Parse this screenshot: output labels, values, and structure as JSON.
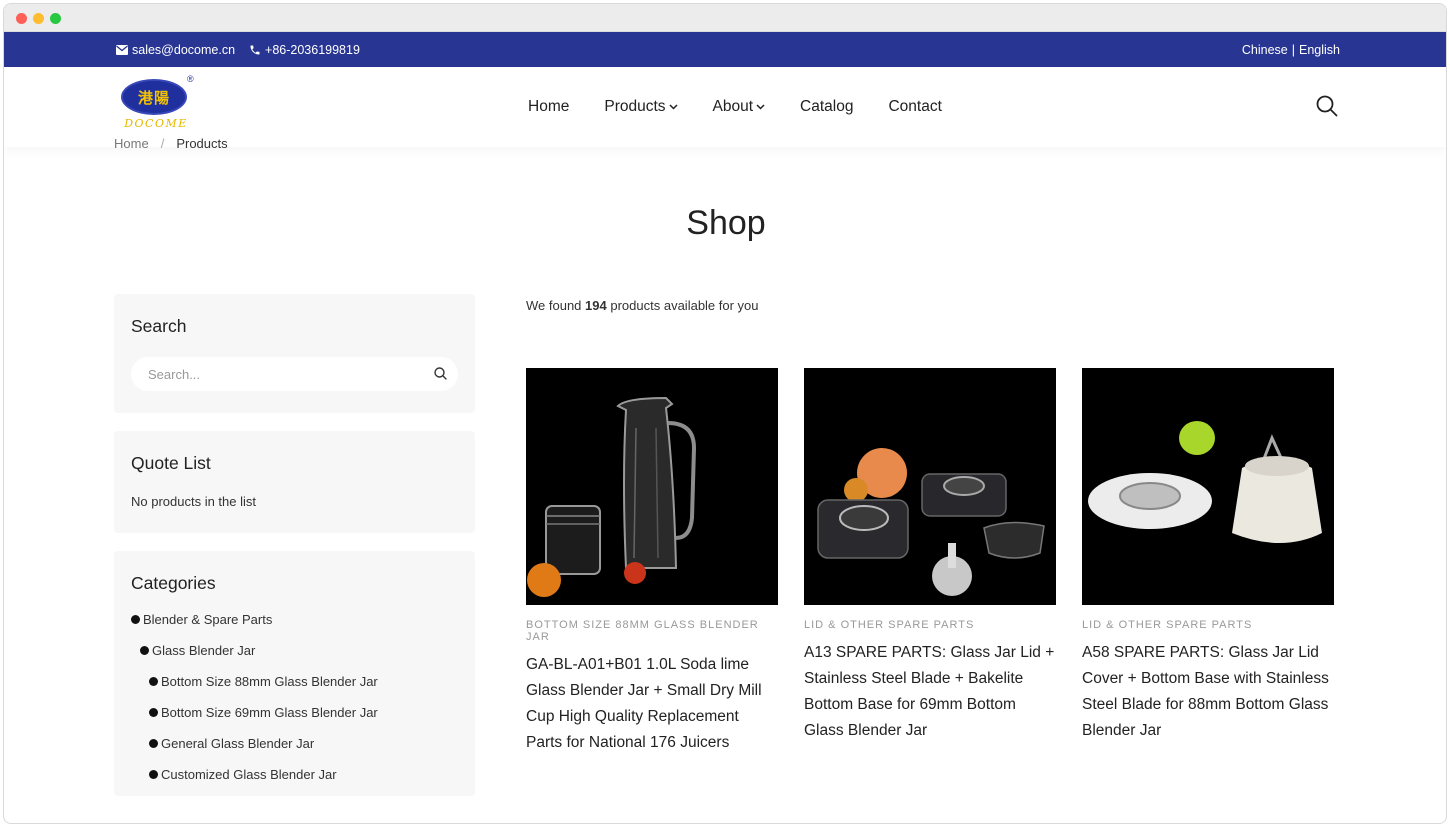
{
  "topbar": {
    "email": "sales@docome.cn",
    "phone": "+86-2036199819",
    "lang_chinese": "Chinese",
    "lang_sep": "|",
    "lang_english": "English"
  },
  "logo": {
    "cn": "港陽",
    "wordmark": "DOCOME",
    "reg": "®"
  },
  "nav": {
    "home": "Home",
    "products": "Products",
    "about": "About",
    "catalog": "Catalog",
    "contact": "Contact"
  },
  "breadcrumb": {
    "home": "Home",
    "sep": "/",
    "current": "Products"
  },
  "page_title": "Shop",
  "sidebar": {
    "search_title": "Search",
    "search_placeholder": "Search...",
    "quote_title": "Quote List",
    "quote_empty": "No products in the list",
    "categories_title": "Categories",
    "categories": [
      {
        "label": "Blender & Spare Parts",
        "level": 0
      },
      {
        "label": "Glass Blender Jar",
        "level": 1
      },
      {
        "label": "Bottom Size 88mm Glass Blender Jar",
        "level": 2
      },
      {
        "label": "Bottom Size 69mm Glass Blender Jar",
        "level": 2
      },
      {
        "label": "General Glass Blender Jar",
        "level": 2
      },
      {
        "label": "Customized Glass Blender Jar",
        "level": 2
      }
    ]
  },
  "results": {
    "prefix": "We found",
    "count": "194",
    "suffix": "products available for you"
  },
  "products": [
    {
      "category": "BOTTOM SIZE 88MM GLASS BLENDER JAR",
      "title": "GA-BL-A01+B01 1.0L Soda lime Glass Blender Jar + Small Dry Mill Cup High Quality Replacement Parts for National 176 Juicers"
    },
    {
      "category": "LID & OTHER SPARE PARTS",
      "title": "A13 SPARE PARTS: Glass Jar Lid + Stainless Steel Blade + Bakelite Bottom Base for 69mm Bottom Glass Blender Jar"
    },
    {
      "category": "LID & OTHER SPARE PARTS",
      "title": "A58 SPARE PARTS: Glass Jar Lid Cover + Bottom Base with Stainless Steel Blade for 88mm Bottom Glass Blender Jar"
    }
  ],
  "colors": {
    "topbar": "#283593",
    "logo_gold": "#e6b800"
  }
}
